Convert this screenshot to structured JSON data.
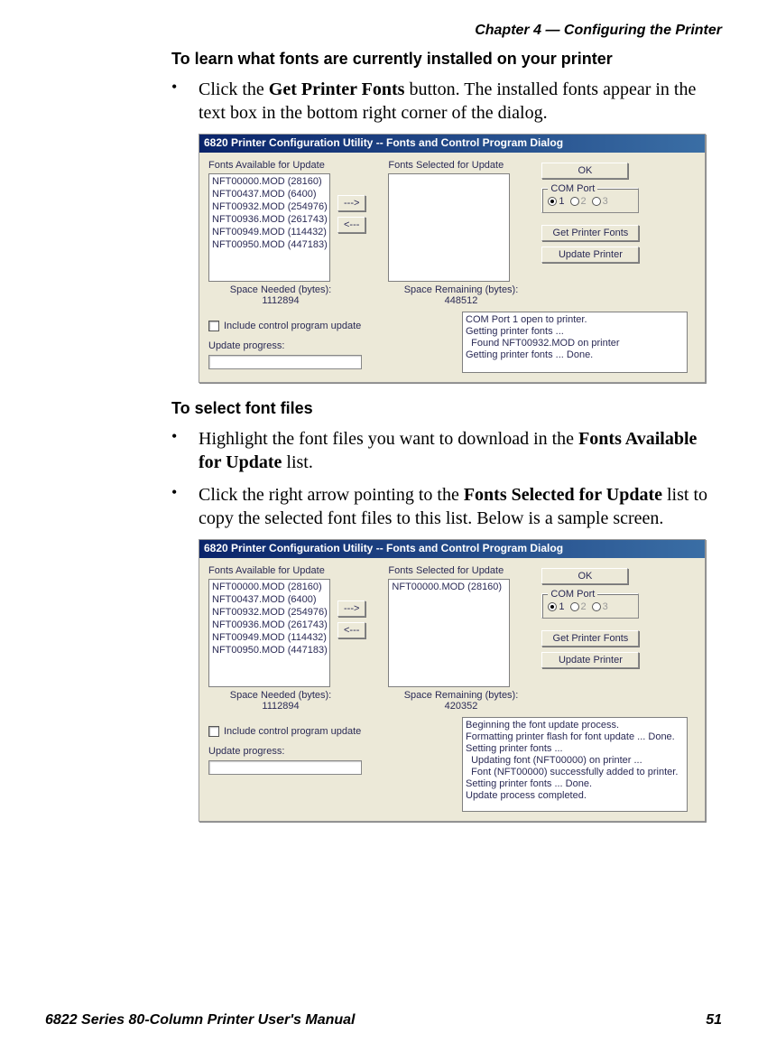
{
  "header": {
    "chapter": "Chapter 4 — Configuring the Printer"
  },
  "footer": {
    "manual": "6822 Series 80-Column Printer User's Manual",
    "page": "51"
  },
  "section1": {
    "heading": "To learn what fonts are currently installed on your printer",
    "bullet1_pre": "Click the ",
    "bullet1_bold": "Get Printer Fonts",
    "bullet1_post": " button. The installed fonts appear in the text box in the bottom right corner of the dialog."
  },
  "section2": {
    "heading": "To select font files",
    "bullet1_pre": "Highlight the font files you want to download in the ",
    "bullet1_bold": "Fonts Available for Update",
    "bullet1_post": " list.",
    "bullet2_pre": "Click the right arrow pointing to the ",
    "bullet2_bold": "Fonts Selected for Update",
    "bullet2_post": " list to copy the selected font files to this list. Below is a sample screen."
  },
  "dialog": {
    "title": "6820 Printer Configuration Utility -- Fonts and Control Program Dialog",
    "fontsAvailLabel": "Fonts Available for Update",
    "fontsSelLabel": "Fonts Selected for Update",
    "availList": "NFT00000.MOD (28160)\nNFT00437.MOD (6400)\nNFT00932.MOD (254976)\nNFT00936.MOD (261743)\nNFT00949.MOD (114432)\nNFT00950.MOD (447183)",
    "arrowRight": "--->",
    "arrowLeft": "<---",
    "ok": "OK",
    "comPort": "COM Port",
    "r1": "1",
    "r2": "2",
    "r3": "3",
    "getFonts": "Get Printer Fonts",
    "updatePrinter": "Update Printer",
    "spaceNeeded": "Space Needed (bytes):",
    "spaceRemain": "Space Remaining (bytes):",
    "needed": "1112894",
    "includeCtrl": "Include control program update",
    "updProg": "Update progress:"
  },
  "shot1": {
    "selList": "",
    "remain": "448512",
    "status": "COM Port 1 open to printer.\nGetting printer fonts ...\n  Found NFT00932.MOD on printer\nGetting printer fonts ... Done."
  },
  "shot2": {
    "selList": "NFT00000.MOD (28160)",
    "remain": "420352",
    "status": "Beginning the font update process.\nFormatting printer flash for font update ... Done.\nSetting printer fonts ...\n  Updating font (NFT00000) on printer ...\n  Font (NFT00000) successfully added to printer.\nSetting printer fonts ... Done.\nUpdate process completed."
  }
}
